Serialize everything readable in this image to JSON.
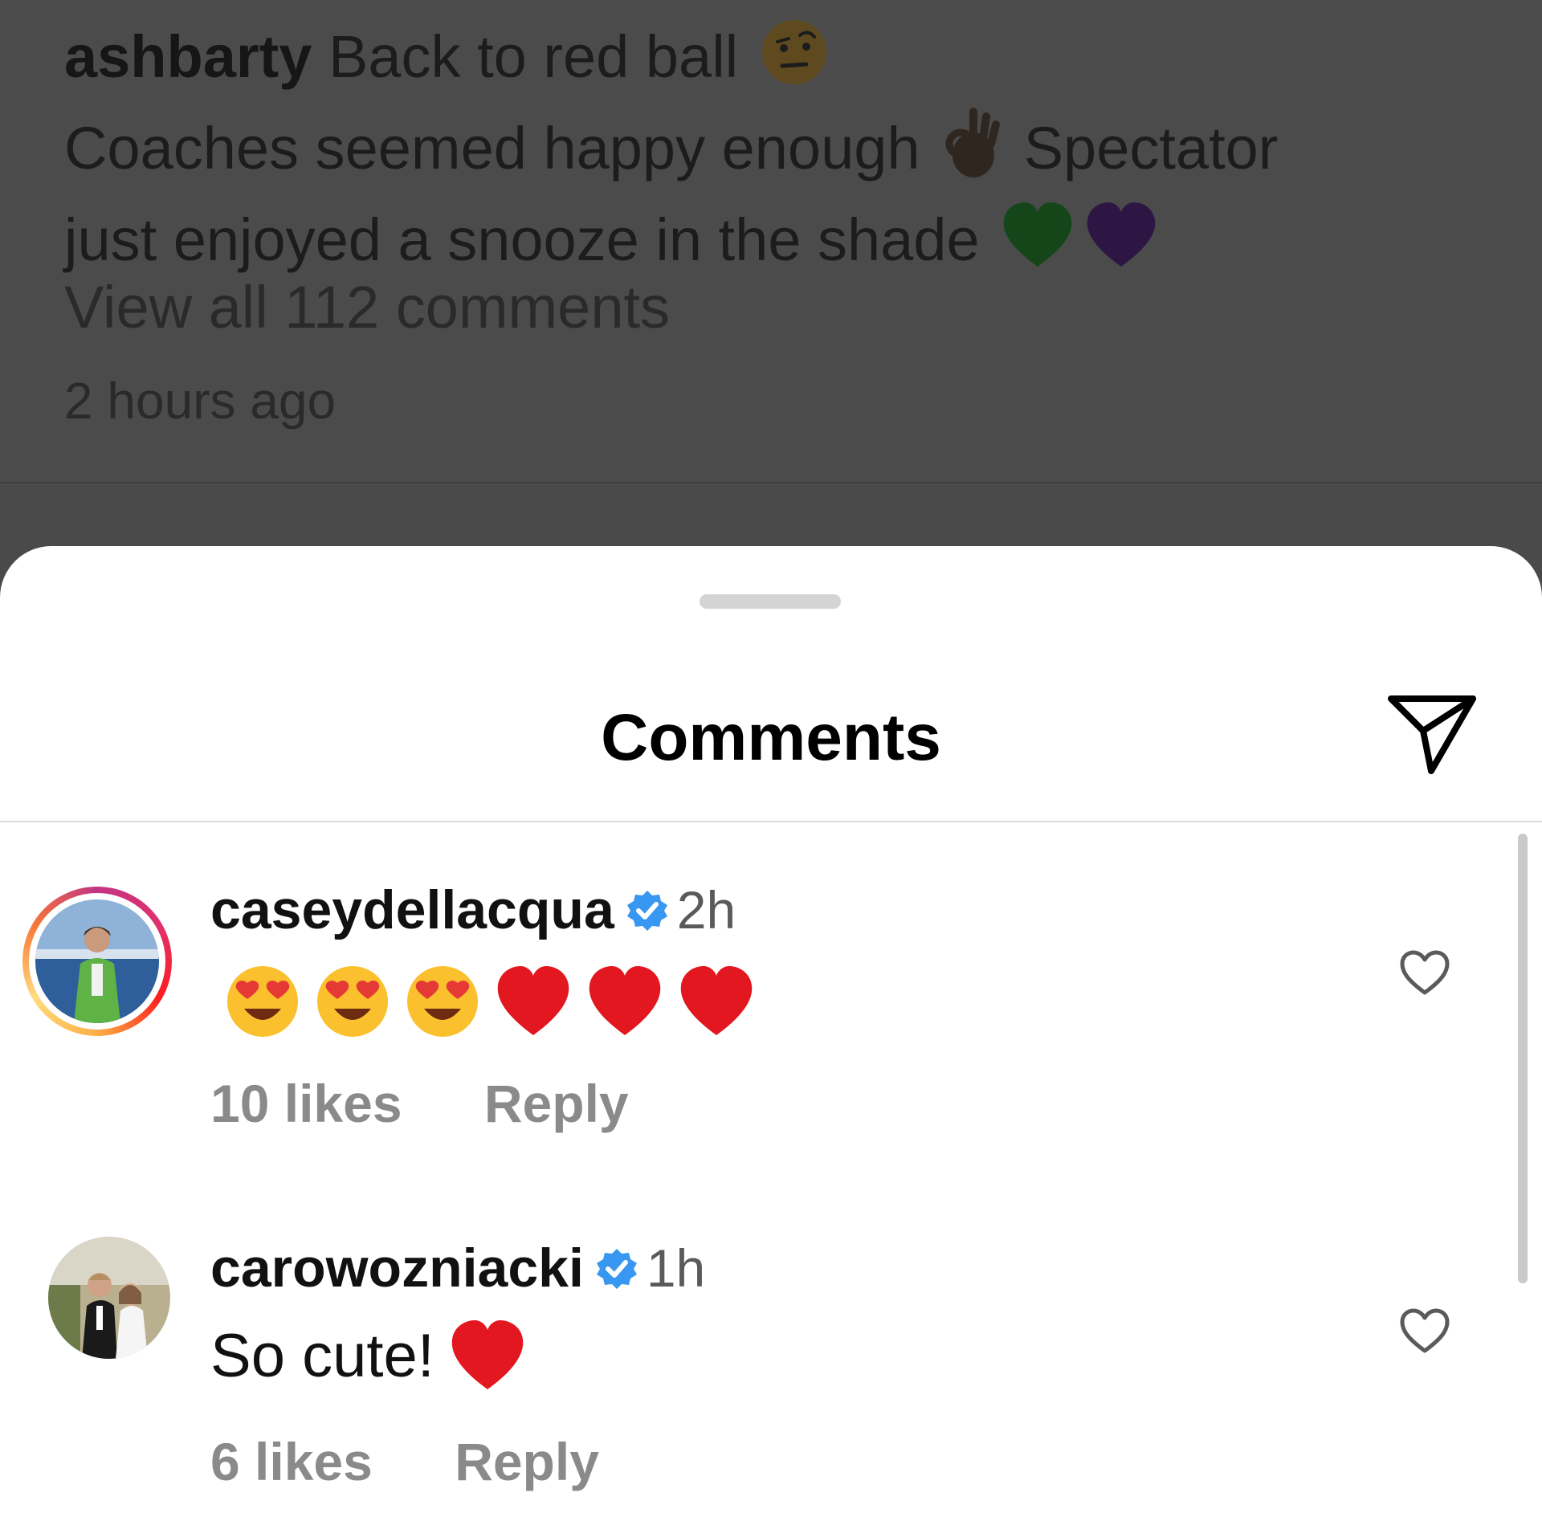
{
  "post": {
    "username": "ashbarty",
    "line1": "Back to red ball",
    "line2": "Coaches seemed happy enough",
    "line2b": "Spectator",
    "line3": "just enjoyed a snooze in the shade",
    "view_all": "View all 112 comments",
    "time_ago": "2 hours ago"
  },
  "sheet": {
    "title": "Comments"
  },
  "comments": [
    {
      "username": "caseydellacqua",
      "time": "2h",
      "body_text": "",
      "emojis": [
        "heart-eyes",
        "heart-eyes",
        "heart-eyes",
        "red-heart",
        "red-heart",
        "red-heart"
      ],
      "likes": "10 likes",
      "reply": "Reply"
    },
    {
      "username": "carowozniacki",
      "time": "1h",
      "body_text": "So cute!",
      "emojis": [
        "red-heart"
      ],
      "likes": "6 likes",
      "reply": "Reply"
    }
  ],
  "colors": {
    "verified": "#3897f0",
    "overlay": "#4b4b4b",
    "sheet": "#ffffff",
    "meta_text": "#8a8a8a"
  },
  "icons": [
    "raised-eyebrow-emoji",
    "ok-hand-emoji",
    "green-heart-emoji",
    "purple-heart-emoji",
    "paper-plane-icon",
    "verified-badge-icon",
    "heart-outline-icon"
  ]
}
